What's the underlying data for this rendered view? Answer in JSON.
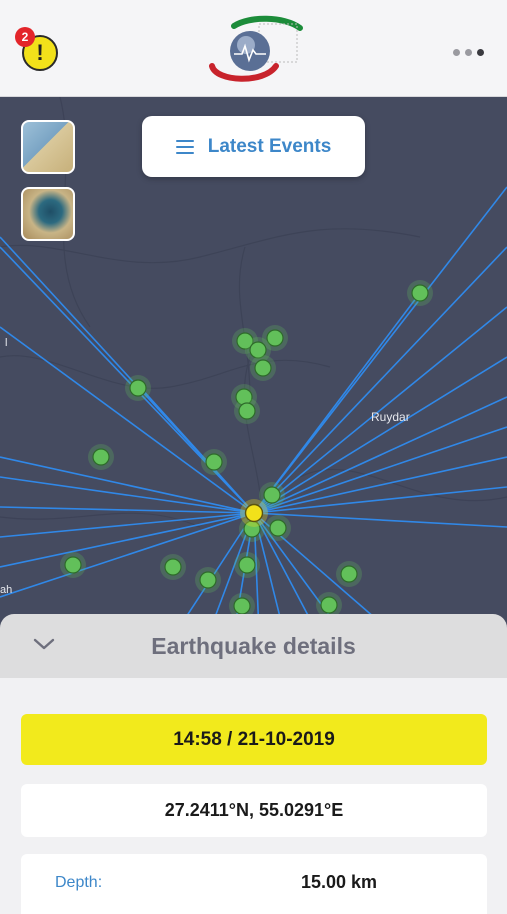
{
  "header": {
    "alert_count": "2",
    "alert_symbol": "!"
  },
  "map": {
    "latest_events_label": "Latest Events",
    "place_labels": [
      "Ruydar",
      "l",
      "ah"
    ],
    "colors": {
      "map_bg": "#454b60",
      "ray": "#2f8cf0",
      "station": "#62c05a",
      "epicenter": "#f2e11a"
    }
  },
  "details": {
    "title": "Earthquake details",
    "datetime": "14:58 / 21-10-2019",
    "coordinates": "27.2411°N, 55.0291°E",
    "depth_label": "Depth:",
    "depth_value": "15.00 km"
  }
}
